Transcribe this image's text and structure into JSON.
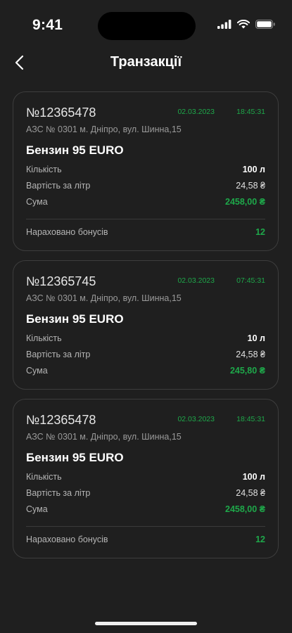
{
  "status_bar": {
    "time": "9:41"
  },
  "header": {
    "title": "Транзакції"
  },
  "labels": {
    "quantity": "Кількість",
    "price_per_liter": "Вартість за літр",
    "sum": "Сума",
    "bonuses": "Нараховано бонусів"
  },
  "transactions": [
    {
      "id": "№12365478",
      "date": "02.03.2023",
      "time": "18:45:31",
      "station": "АЗС № 0301 м. Дніпро, вул. Шинна,15",
      "fuel": "Бензин 95 EURO",
      "quantity": "100 л",
      "price": "24,58 ₴",
      "sum": "2458,00 ₴",
      "bonuses": "12"
    },
    {
      "id": "№12365745",
      "date": "02.03.2023",
      "time": "07:45:31",
      "station": "АЗС № 0301 м. Дніпро, вул. Шинна,15",
      "fuel": "Бензин 95 EURO",
      "quantity": "10 л",
      "price": "24,58 ₴",
      "sum": "245,80 ₴"
    },
    {
      "id": "№12365478",
      "date": "02.03.2023",
      "time": "18:45:31",
      "station": "АЗС № 0301 м. Дніпро, вул. Шинна,15",
      "fuel": "Бензин 95 EURO",
      "quantity": "100 л",
      "price": "24,58 ₴",
      "sum": "2458,00 ₴",
      "bonuses": "12"
    }
  ],
  "colors": {
    "background": "#1f1f1f",
    "accent_green": "#1ea84a",
    "card_border": "#3d3d3d"
  },
  "icons": [
    "signal-icon",
    "wifi-icon",
    "battery-icon",
    "back-arrow-icon"
  ]
}
